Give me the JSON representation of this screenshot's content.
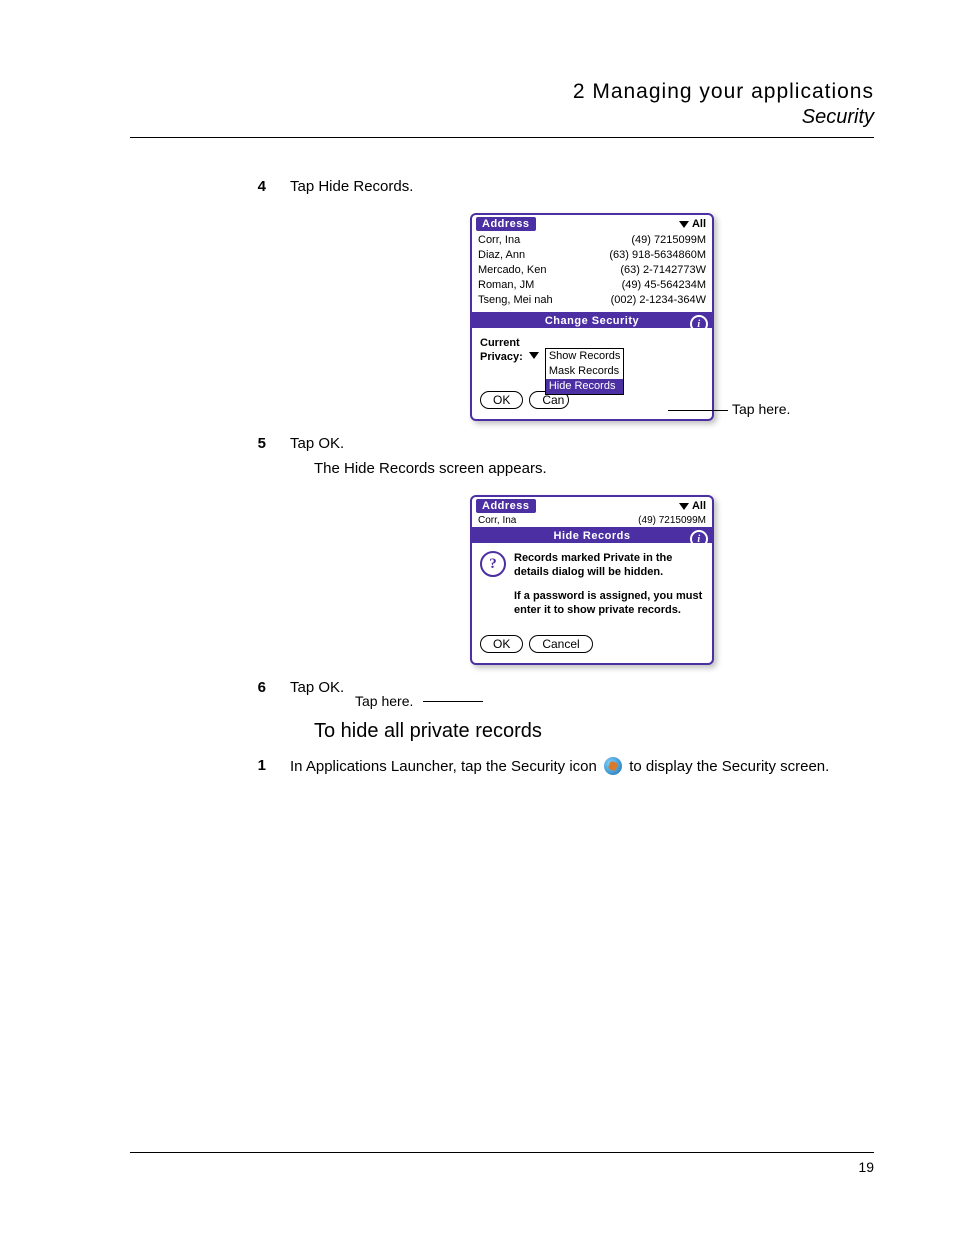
{
  "header": {
    "chapter": "2 Managing your applications",
    "section": "Security"
  },
  "steps": {
    "s4": {
      "num": "4",
      "text": "Tap Hide Records."
    },
    "s5": {
      "num": "5",
      "text": "Tap OK."
    },
    "s5_sub": "The Hide Records screen appears.",
    "s6": {
      "num": "6",
      "text": "Tap OK."
    }
  },
  "subheading": "To hide all private records",
  "step1": {
    "num": "1",
    "pre": "In Applications Launcher, tap the Security icon ",
    "post": " to display the Security screen."
  },
  "fig1": {
    "app": "Address",
    "category": "All",
    "rows": [
      {
        "name": "Corr, Ina",
        "phone": "(49) 7215099M"
      },
      {
        "name": "Diaz, Ann",
        "phone": "(63) 918-5634860M"
      },
      {
        "name": "Mercado, Ken",
        "phone": "(63) 2-7142773W"
      },
      {
        "name": "Roman, JM",
        "phone": "(49) 45-564234M"
      },
      {
        "name": "Tseng, Mei nah",
        "phone": "(002) 2-1234-364W"
      }
    ],
    "dlg_title": "Change Security",
    "privacy_label1": "Current",
    "privacy_label2": "Privacy:",
    "options": [
      "Show Records",
      "Mask Records",
      "Hide Records"
    ],
    "ok": "OK",
    "cancel": "Can",
    "callout": "Tap here."
  },
  "fig2": {
    "app": "Address",
    "category": "All",
    "peek": {
      "name": "Corr, Ina",
      "phone": "(49) 7215099M"
    },
    "dlg_title": "Hide Records",
    "msg1": "Records marked Private in the details dialog will be hidden.",
    "msg2": "If a password is assigned, you must enter it to show private records.",
    "ok": "OK",
    "cancel": "Cancel",
    "callout": "Tap here."
  },
  "page_number": "19"
}
